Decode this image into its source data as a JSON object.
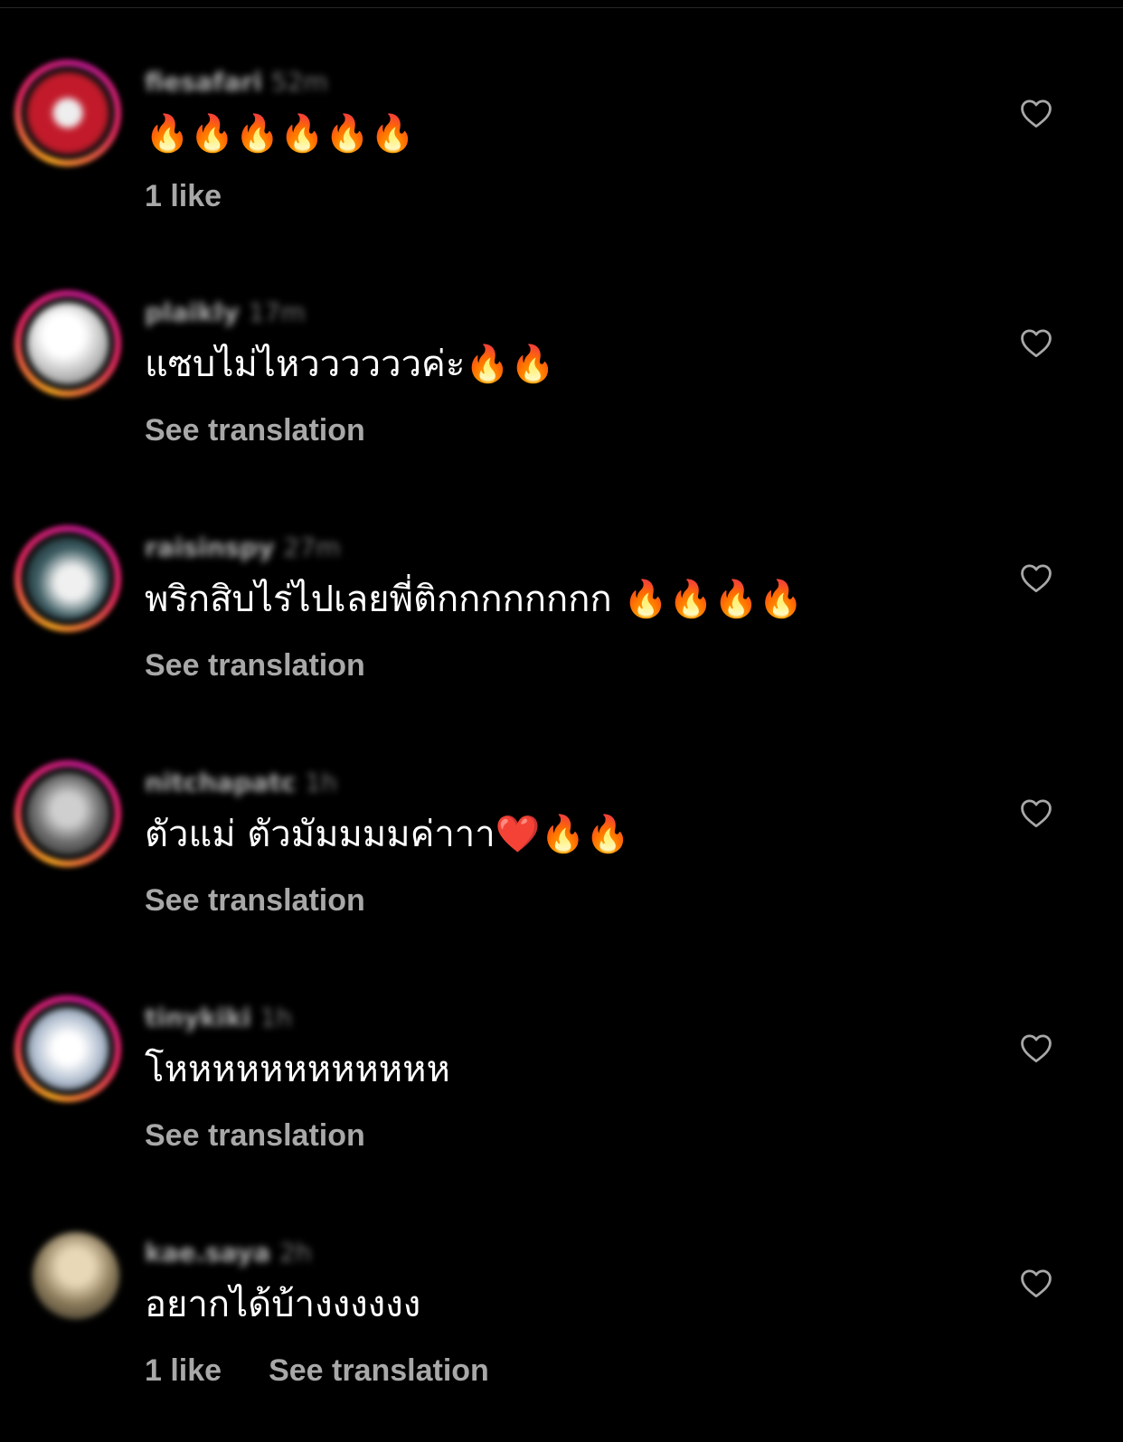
{
  "comments": [
    {
      "username": "fiesafari",
      "time": "52m",
      "text": "🔥🔥🔥🔥🔥🔥",
      "likes": "1 like",
      "translate": "",
      "avatar_color": "#c21a2a"
    },
    {
      "username": "plaikly",
      "time": "17m",
      "text": "แซบไม่ไหววววววค่ะ🔥🔥",
      "likes": "",
      "translate": "See translation",
      "avatar_color": "#d8d8d8"
    },
    {
      "username": "raisinspy",
      "time": "27m",
      "text": "พริกสิบไร่ไปเลยพี่ติกกกกกกกก 🔥🔥🔥🔥",
      "likes": "",
      "translate": "See translation",
      "avatar_color": "#3a5a60"
    },
    {
      "username": "nitchapatc",
      "time": "1h",
      "text": "ตัวแม่ ตัวมัมมมมค่าาา❤️🔥🔥",
      "likes": "",
      "translate": "See translation",
      "avatar_color": "#6a6a6a"
    },
    {
      "username": "tinykiki",
      "time": "1h",
      "text": "โหหหหหหหหหหหห",
      "likes": "",
      "translate": "See translation",
      "avatar_color": "#b8c4d4"
    },
    {
      "username": "kae.saya",
      "time": "2h",
      "text": "อยากได้บ้างงงงงง",
      "likes": "1 like",
      "translate": "See translation",
      "avatar_color": "#8a7a5a"
    }
  ],
  "icons": {
    "like": "heart-outline-icon"
  },
  "colors": {
    "background": "#000000",
    "text": "#ffffff",
    "secondary": "#a8a8a8"
  }
}
